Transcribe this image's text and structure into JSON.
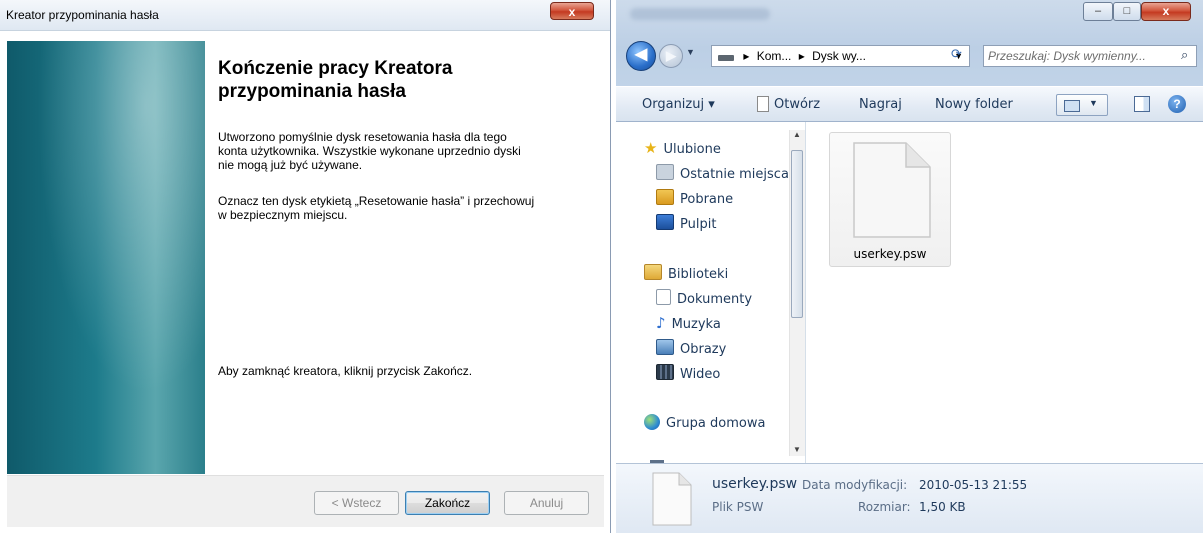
{
  "wizard": {
    "title": "Kreator przypominania hasła",
    "close_glyph": "x",
    "heading_line1": "Kończenie pracy Kreatora",
    "heading_line2": "przypominania hasła",
    "para1_line1": "Utworzono pomyślnie dysk resetowania hasła dla tego",
    "para1_line2": "konta użytkownika. Wszystkie wykonane uprzednio dyski",
    "para1_line3": "nie mogą już być używane.",
    "para2_line1": "Oznacz ten dysk etykietą „Resetowanie hasła” i przechowuj",
    "para2_line2": "w bezpiecznym miejscu.",
    "closing_text": "Aby zamknąć kreatora, kliknij przycisk Zakończ.",
    "back_button": "< Wstecz",
    "finish_button": "Zakończ",
    "cancel_button": "Anuluj"
  },
  "explorer": {
    "caption": {
      "minimize": "–",
      "maximize": "□",
      "close": "x"
    },
    "back_glyph": "◀",
    "forward_glyph": "▶",
    "address": {
      "crumb1": "Kom...",
      "crumb2": "Dysk wy...",
      "separator": "▸"
    },
    "search_placeholder": "Przeszukaj: Dysk wymienny...",
    "toolbar": {
      "organize": "Organizuj ▾",
      "open": "Otwórz",
      "burn": "Nagraj",
      "new_folder": "Nowy folder"
    },
    "nav": {
      "favorites": "Ulubione",
      "recent": "Ostatnie miejsca",
      "downloads": "Pobrane",
      "desktop": "Pulpit",
      "libraries": "Biblioteki",
      "documents": "Dokumenty",
      "music": "Muzyka",
      "pictures": "Obrazy",
      "video": "Wideo",
      "homegroup": "Grupa domowa"
    },
    "file": {
      "name": "userkey.psw"
    },
    "details": {
      "name": "userkey.psw",
      "type": "Plik PSW",
      "modified_label": "Data modyfikacji:",
      "modified_value": "2010-05-13 21:55",
      "size_label": "Rozmiar:",
      "size_value": "1,50 KB"
    }
  },
  "colors": {
    "wizard_accent": "#1d7b8b",
    "explorer_frame": "#c5d7ea",
    "link_text": "#1e395b"
  }
}
